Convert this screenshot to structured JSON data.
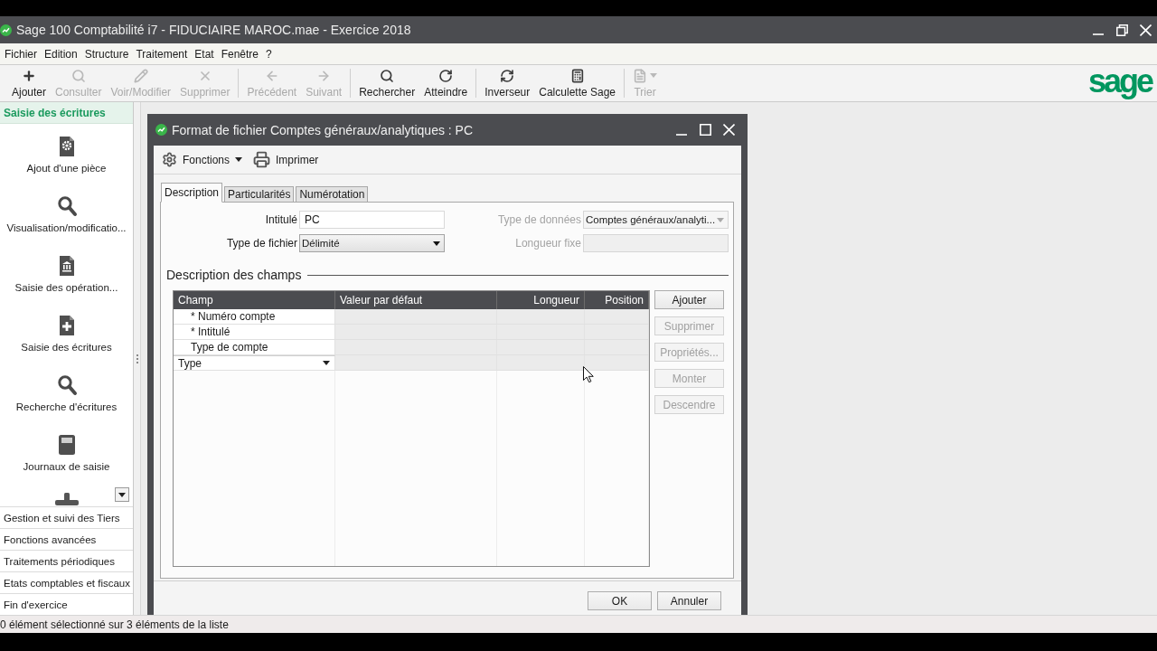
{
  "window": {
    "title": "Sage 100 Comptabilité i7 - FIDUCIAIRE MAROC.mae - Exercice 2018"
  },
  "menu": [
    "Fichier",
    "Edition",
    "Structure",
    "Traitement",
    "Etat",
    "Fenêtre",
    "?"
  ],
  "toolbar": {
    "groups": [
      [
        {
          "label": "Ajouter",
          "disabled": false,
          "dropdown": false
        },
        {
          "label": "Consulter",
          "disabled": true,
          "dropdown": false
        },
        {
          "label": "Voir/Modifier",
          "disabled": true,
          "dropdown": false
        },
        {
          "label": "Supprimer",
          "disabled": true,
          "dropdown": false
        }
      ],
      [
        {
          "label": "Précédent",
          "disabled": true,
          "dropdown": false
        },
        {
          "label": "Suivant",
          "disabled": true,
          "dropdown": false
        }
      ],
      [
        {
          "label": "Rechercher",
          "disabled": false,
          "dropdown": false
        },
        {
          "label": "Atteindre",
          "disabled": false,
          "dropdown": false
        }
      ],
      [
        {
          "label": "Inverseur",
          "disabled": false,
          "dropdown": false
        },
        {
          "label": "Calculette Sage",
          "disabled": false,
          "dropdown": false
        }
      ],
      [
        {
          "label": "Trier",
          "disabled": true,
          "dropdown": true
        }
      ]
    ],
    "logo": "sage"
  },
  "sidebar": {
    "active_group": "Saisie des écritures",
    "items": [
      "Ajout d'une pièce",
      "Visualisation/modificatio...",
      "Saisie des opération...",
      "Saisie des écritures",
      "Recherche d'écritures",
      "Journaux de saisie"
    ],
    "groups": [
      "Gestion et suivi des Tiers",
      "Fonctions avancées",
      "Traitements périodiques",
      "Etats comptables et fiscaux",
      "Fin d'exercice"
    ]
  },
  "dialog": {
    "title": "Format de fichier Comptes généraux/analytiques : PC",
    "toolbar": [
      {
        "label": "Fonctions",
        "dropdown": true
      },
      {
        "label": "Imprimer",
        "dropdown": false
      }
    ],
    "tabs": [
      {
        "label": "Description",
        "selected": true
      },
      {
        "label": "Particularités",
        "selected": false
      },
      {
        "label": "Numérotation",
        "selected": false
      }
    ],
    "fields": [
      {
        "label": "Intitulé",
        "kind": "text",
        "value": "PC",
        "disabled": false
      },
      {
        "label": "Type de données",
        "kind": "select",
        "value": "Comptes généraux/analyti...",
        "disabled": true
      },
      {
        "label": "Type de fichier",
        "kind": "select",
        "value": "Délimité",
        "disabled": false
      },
      {
        "label": "Longueur fixe",
        "kind": "text",
        "disabled": true
      }
    ],
    "section_title": "Description des champs",
    "table": {
      "columns": [
        "Champ",
        "Valeur par défaut",
        "Longueur",
        "Position"
      ],
      "rows": [
        {
          "champ": "* Numéro compte",
          "editing": false
        },
        {
          "champ": "* Intitulé",
          "editing": false
        },
        {
          "champ": "Type de compte",
          "editing": false
        },
        {
          "champ": "Type",
          "editing": true
        }
      ]
    },
    "side_buttons": [
      {
        "label": "Ajouter",
        "disabled": false
      },
      {
        "label": "Supprimer",
        "disabled": true
      },
      {
        "label": "Propriétés...",
        "disabled": true
      },
      {
        "label": "Monter",
        "disabled": true
      },
      {
        "label": "Descendre",
        "disabled": true
      }
    ],
    "buttons": [
      "OK",
      "Annuler"
    ]
  },
  "status_bar": "0 élément sélectionné sur 3 éléments de la liste"
}
